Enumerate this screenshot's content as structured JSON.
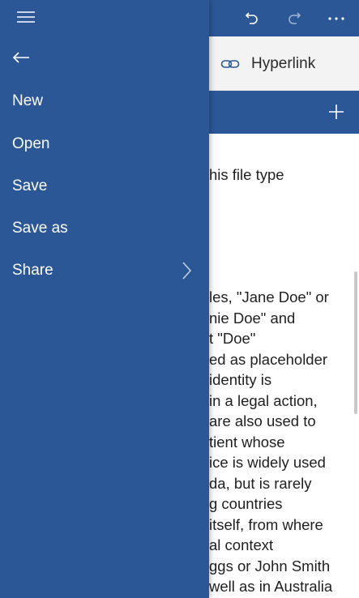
{
  "toolbar": {
    "undo_icon": "undo-icon",
    "redo_icon": "redo-icon",
    "more_icon": "more-icon"
  },
  "ribbon": {
    "hyperlink_label": "Hyperlink",
    "hyperlink_icon": "link-icon"
  },
  "addbar": {
    "add_icon": "plus-icon"
  },
  "document": {
    "lines": [
      "his file type",
      "les, \"Jane Doe\" or",
      "nie Doe\" and",
      "t \"Doe\"",
      "ed as placeholder",
      "identity is",
      "in a legal action,",
      "are also used to",
      "tient whose",
      "ice is widely used",
      "da, but is rarely",
      "g countries",
      "itself, from where",
      "al context",
      "ggs or John Smith",
      "well as in Australia"
    ]
  },
  "nav": {
    "hamburger_icon": "hamburger-icon",
    "back_icon": "back-arrow-icon",
    "items": [
      {
        "label": "New"
      },
      {
        "label": "Open"
      },
      {
        "label": "Save"
      },
      {
        "label": "Save as"
      },
      {
        "label": "Share",
        "has_submenu": true
      }
    ]
  },
  "colors": {
    "accent": "#2b5797",
    "ribbon_bg": "#f3f3f3",
    "doc_text": "#1f1f1f"
  }
}
